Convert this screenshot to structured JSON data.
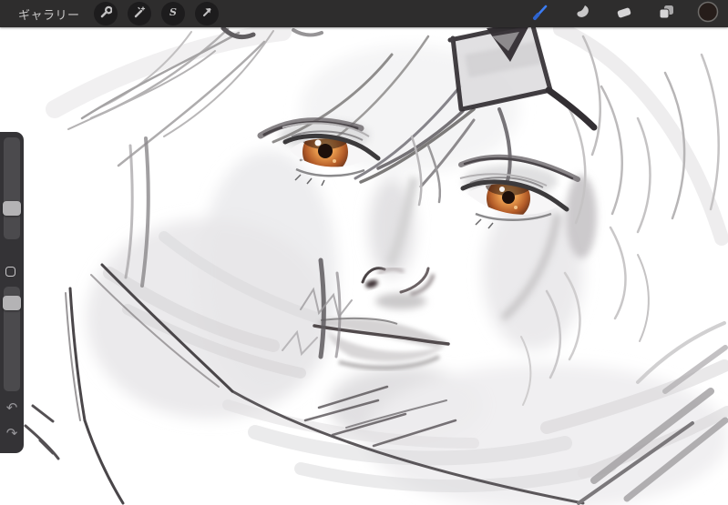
{
  "topbar": {
    "background_color": "#2e2d2d",
    "gallery_label": "ギャラリー",
    "left_tools": [
      {
        "name": "actions",
        "icon": "wrench-icon"
      },
      {
        "name": "adjustments",
        "icon": "magic-wand-icon"
      },
      {
        "name": "selection",
        "icon": "selection-s-icon"
      },
      {
        "name": "transform",
        "icon": "transform-arrow-icon"
      }
    ],
    "right_tools": [
      {
        "name": "paint",
        "icon": "brush-icon",
        "active": true,
        "active_color": "#3b7cf3"
      },
      {
        "name": "smudge",
        "icon": "smudge-icon"
      },
      {
        "name": "erase",
        "icon": "eraser-icon"
      },
      {
        "name": "layers",
        "icon": "layers-icon"
      },
      {
        "name": "color",
        "icon": "color-swatch-circle",
        "swatch_color": "#261d1a",
        "ring_color": "#6e6c6a"
      }
    ]
  },
  "sidebar": {
    "brush_size_slider": {
      "handle_top_pct": 21.5
    },
    "modify_button": {
      "icon": "square-outline-icon"
    },
    "opacity_slider": {
      "handle_top_pct": 51.0
    },
    "undo_icon": "↶",
    "redo_icon": "↷"
  },
  "canvas": {
    "background_color": "#ffffff",
    "content": "grayscale digital portrait sketch: white-haired character with amber-orange eyes, dark sketched forehead plate, rough scarf and hair strokes",
    "eye_iris_color": "#c0662f"
  }
}
